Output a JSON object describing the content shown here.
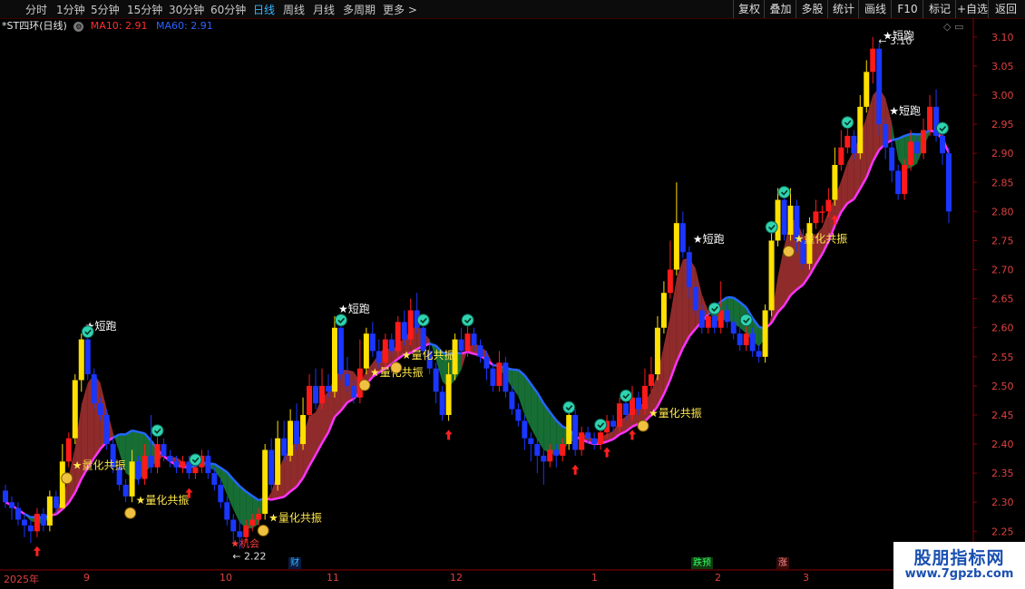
{
  "toolbar": {
    "timeframes": [
      "分时",
      "1分钟",
      "5分钟",
      "15分钟",
      "30分钟",
      "60分钟",
      "日线",
      "周线",
      "月线",
      "多周期",
      "更多 >"
    ],
    "active_index": 6,
    "buttons": [
      "复权",
      "叠加",
      "多股",
      "统计",
      "画线",
      "F10",
      "标记",
      "+自选",
      "返回"
    ]
  },
  "legend": {
    "name": "*ST四环(日线)",
    "ma10": "MA10: 2.91",
    "ma60": "MA60: 2.91"
  },
  "corner": "◇ ▭",
  "colors": {
    "up": "#ff1a1a",
    "down": "#1a36ff",
    "strong": "#ffe000",
    "ma_line": "#ff33ff",
    "band_up": "#a03030",
    "band_down": "#1a7a3a",
    "ma60_line": "#2468ff",
    "axis": "#8a0000"
  },
  "chart_data": {
    "type": "candlestick",
    "ylim": [
      2.21,
      3.12
    ],
    "y_ticks": [
      "3.10",
      "3.05",
      "3.00",
      "2.95",
      "2.90",
      "2.85",
      "2.80",
      "2.75",
      "2.70",
      "2.65",
      "2.60",
      "2.55",
      "2.50",
      "2.45",
      "2.40",
      "2.35",
      "2.30",
      "2.25"
    ],
    "x_labels": [
      "2025年",
      "9",
      "10",
      "11",
      "12",
      "1",
      "2",
      "3"
    ],
    "high_marker": "3.10",
    "low_marker": "2.22",
    "signals": {
      "short_run": "短跑",
      "resonance": "量化共振",
      "chance": "机会"
    },
    "bottom_tags": [
      "财",
      "跌预",
      "涨"
    ],
    "candles": [
      [
        2.32,
        2.3,
        2.33,
        2.29
      ],
      [
        2.3,
        2.29,
        2.31,
        2.27
      ],
      [
        2.29,
        2.27,
        2.3,
        2.26
      ],
      [
        2.27,
        2.26,
        2.28,
        2.24
      ],
      [
        2.26,
        2.25,
        2.27,
        2.23
      ],
      [
        2.25,
        2.28,
        2.29,
        2.24
      ],
      [
        2.28,
        2.26,
        2.29,
        2.25
      ],
      [
        2.26,
        2.31,
        2.32,
        2.25
      ],
      [
        2.31,
        2.29,
        2.32,
        2.28
      ],
      [
        2.29,
        2.37,
        2.4,
        2.29
      ],
      [
        2.37,
        2.41,
        2.42,
        2.36
      ],
      [
        2.41,
        2.51,
        2.52,
        2.4
      ],
      [
        2.51,
        2.58,
        2.59,
        2.49
      ],
      [
        2.58,
        2.52,
        2.59,
        2.51
      ],
      [
        2.52,
        2.47,
        2.53,
        2.46
      ],
      [
        2.47,
        2.45,
        2.48,
        2.44
      ],
      [
        2.45,
        2.4,
        2.46,
        2.39
      ],
      [
        2.4,
        2.36,
        2.41,
        2.35
      ],
      [
        2.36,
        2.33,
        2.37,
        2.32
      ],
      [
        2.33,
        2.31,
        2.34,
        2.3
      ],
      [
        2.31,
        2.37,
        2.39,
        2.3
      ],
      [
        2.37,
        2.34,
        2.38,
        2.33
      ],
      [
        2.34,
        2.38,
        2.4,
        2.33
      ],
      [
        2.38,
        2.36,
        2.45,
        2.35
      ],
      [
        2.36,
        2.4,
        2.42,
        2.35
      ],
      [
        2.4,
        2.38,
        2.41,
        2.37
      ],
      [
        2.38,
        2.37,
        2.39,
        2.36
      ],
      [
        2.37,
        2.36,
        2.38,
        2.35
      ],
      [
        2.36,
        2.37,
        2.38,
        2.35
      ],
      [
        2.37,
        2.35,
        2.38,
        2.34
      ],
      [
        2.35,
        2.36,
        2.37,
        2.34
      ],
      [
        2.36,
        2.38,
        2.39,
        2.35
      ],
      [
        2.38,
        2.35,
        2.39,
        2.34
      ],
      [
        2.35,
        2.33,
        2.36,
        2.32
      ],
      [
        2.33,
        2.3,
        2.34,
        2.29
      ],
      [
        2.3,
        2.27,
        2.31,
        2.26
      ],
      [
        2.27,
        2.25,
        2.28,
        2.23
      ],
      [
        2.25,
        2.24,
        2.27,
        2.22
      ],
      [
        2.24,
        2.26,
        2.27,
        2.23
      ],
      [
        2.26,
        2.27,
        2.28,
        2.25
      ],
      [
        2.27,
        2.28,
        2.29,
        2.26
      ],
      [
        2.28,
        2.39,
        2.4,
        2.27
      ],
      [
        2.39,
        2.33,
        2.41,
        2.32
      ],
      [
        2.33,
        2.41,
        2.44,
        2.32
      ],
      [
        2.41,
        2.38,
        2.44,
        2.37
      ],
      [
        2.38,
        2.44,
        2.46,
        2.37
      ],
      [
        2.44,
        2.4,
        2.47,
        2.39
      ],
      [
        2.4,
        2.45,
        2.48,
        2.39
      ],
      [
        2.45,
        2.5,
        2.52,
        2.44
      ],
      [
        2.5,
        2.47,
        2.53,
        2.46
      ],
      [
        2.47,
        2.5,
        2.53,
        2.46
      ],
      [
        2.5,
        2.49,
        2.52,
        2.48
      ],
      [
        2.49,
        2.6,
        2.62,
        2.48
      ],
      [
        2.6,
        2.52,
        2.61,
        2.51
      ],
      [
        2.52,
        2.5,
        2.55,
        2.49
      ],
      [
        2.5,
        2.48,
        2.51,
        2.47
      ],
      [
        2.48,
        2.53,
        2.58,
        2.47
      ],
      [
        2.53,
        2.59,
        2.6,
        2.52
      ],
      [
        2.59,
        2.56,
        2.61,
        2.55
      ],
      [
        2.56,
        2.54,
        2.58,
        2.53
      ],
      [
        2.54,
        2.58,
        2.59,
        2.53
      ],
      [
        2.58,
        2.56,
        2.59,
        2.55
      ],
      [
        2.56,
        2.61,
        2.62,
        2.55
      ],
      [
        2.61,
        2.58,
        2.63,
        2.57
      ],
      [
        2.58,
        2.63,
        2.65,
        2.57
      ],
      [
        2.63,
        2.6,
        2.66,
        2.59
      ],
      [
        2.6,
        2.56,
        2.61,
        2.55
      ],
      [
        2.56,
        2.53,
        2.57,
        2.52
      ],
      [
        2.53,
        2.49,
        2.54,
        2.47
      ],
      [
        2.49,
        2.45,
        2.5,
        2.44
      ],
      [
        2.45,
        2.52,
        2.54,
        2.44
      ],
      [
        2.52,
        2.58,
        2.59,
        2.51
      ],
      [
        2.58,
        2.56,
        2.6,
        2.55
      ],
      [
        2.56,
        2.59,
        2.61,
        2.55
      ],
      [
        2.59,
        2.57,
        2.6,
        2.56
      ],
      [
        2.57,
        2.55,
        2.58,
        2.54
      ],
      [
        2.55,
        2.53,
        2.56,
        2.51
      ],
      [
        2.53,
        2.5,
        2.54,
        2.49
      ],
      [
        2.5,
        2.54,
        2.56,
        2.49
      ],
      [
        2.54,
        2.49,
        2.55,
        2.48
      ],
      [
        2.49,
        2.46,
        2.5,
        2.45
      ],
      [
        2.46,
        2.44,
        2.47,
        2.43
      ],
      [
        2.44,
        2.41,
        2.45,
        2.39
      ],
      [
        2.41,
        2.4,
        2.42,
        2.37
      ],
      [
        2.4,
        2.38,
        2.41,
        2.35
      ],
      [
        2.38,
        2.37,
        2.39,
        2.33
      ],
      [
        2.37,
        2.39,
        2.4,
        2.36
      ],
      [
        2.39,
        2.38,
        2.4,
        2.36
      ],
      [
        2.38,
        2.4,
        2.41,
        2.37
      ],
      [
        2.4,
        2.45,
        2.46,
        2.39
      ],
      [
        2.45,
        2.39,
        2.46,
        2.38
      ],
      [
        2.39,
        2.42,
        2.43,
        2.38
      ],
      [
        2.42,
        2.41,
        2.43,
        2.4
      ],
      [
        2.41,
        2.4,
        2.42,
        2.39
      ],
      [
        2.4,
        2.42,
        2.43,
        2.39
      ],
      [
        2.42,
        2.44,
        2.45,
        2.41
      ],
      [
        2.44,
        2.43,
        2.45,
        2.42
      ],
      [
        2.43,
        2.47,
        2.48,
        2.42
      ],
      [
        2.47,
        2.45,
        2.48,
        2.44
      ],
      [
        2.45,
        2.48,
        2.5,
        2.44
      ],
      [
        2.48,
        2.46,
        2.49,
        2.45
      ],
      [
        2.46,
        2.5,
        2.53,
        2.45
      ],
      [
        2.5,
        2.52,
        2.55,
        2.49
      ],
      [
        2.52,
        2.6,
        2.62,
        2.51
      ],
      [
        2.6,
        2.66,
        2.68,
        2.59
      ],
      [
        2.66,
        2.7,
        2.75,
        2.65
      ],
      [
        2.7,
        2.78,
        2.85,
        2.69
      ],
      [
        2.78,
        2.73,
        2.8,
        2.72
      ],
      [
        2.73,
        2.67,
        2.74,
        2.65
      ],
      [
        2.67,
        2.63,
        2.68,
        2.62
      ],
      [
        2.63,
        2.6,
        2.64,
        2.59
      ],
      [
        2.6,
        2.62,
        2.63,
        2.59
      ],
      [
        2.62,
        2.6,
        2.63,
        2.59
      ],
      [
        2.6,
        2.63,
        2.68,
        2.59
      ],
      [
        2.63,
        2.61,
        2.64,
        2.6
      ],
      [
        2.61,
        2.59,
        2.62,
        2.58
      ],
      [
        2.59,
        2.57,
        2.6,
        2.56
      ],
      [
        2.57,
        2.59,
        2.61,
        2.56
      ],
      [
        2.59,
        2.56,
        2.6,
        2.55
      ],
      [
        2.56,
        2.55,
        2.57,
        2.54
      ],
      [
        2.55,
        2.63,
        2.64,
        2.54
      ],
      [
        2.63,
        2.75,
        2.77,
        2.62
      ],
      [
        2.75,
        2.82,
        2.84,
        2.74
      ],
      [
        2.82,
        2.76,
        2.83,
        2.75
      ],
      [
        2.76,
        2.81,
        2.84,
        2.75
      ],
      [
        2.81,
        2.75,
        2.82,
        2.73
      ],
      [
        2.75,
        2.71,
        2.77,
        2.7
      ],
      [
        2.71,
        2.78,
        2.79,
        2.7
      ],
      [
        2.78,
        2.8,
        2.82,
        2.77
      ],
      [
        2.8,
        2.8,
        2.81,
        2.78
      ],
      [
        2.8,
        2.82,
        2.84,
        2.79
      ],
      [
        2.82,
        2.88,
        2.91,
        2.81
      ],
      [
        2.88,
        2.91,
        2.94,
        2.87
      ],
      [
        2.91,
        2.93,
        2.95,
        2.9
      ],
      [
        2.93,
        2.9,
        2.94,
        2.89
      ],
      [
        2.9,
        2.98,
        3.0,
        2.89
      ],
      [
        2.98,
        3.04,
        3.06,
        2.97
      ],
      [
        3.04,
        3.08,
        3.1,
        3.02
      ],
      [
        3.08,
        2.95,
        3.09,
        2.93
      ],
      [
        2.95,
        2.91,
        2.96,
        2.89
      ],
      [
        2.91,
        2.87,
        2.92,
        2.85
      ],
      [
        2.87,
        2.83,
        2.88,
        2.82
      ],
      [
        2.83,
        2.88,
        2.89,
        2.82
      ],
      [
        2.88,
        2.92,
        2.94,
        2.87
      ],
      [
        2.92,
        2.9,
        2.93,
        2.89
      ],
      [
        2.9,
        2.94,
        2.96,
        2.89
      ],
      [
        2.94,
        2.98,
        3.0,
        2.93
      ],
      [
        2.98,
        2.93,
        3.01,
        2.92
      ],
      [
        2.93,
        2.9,
        2.94,
        2.88
      ],
      [
        2.9,
        2.8,
        2.91,
        2.78
      ]
    ]
  }
}
